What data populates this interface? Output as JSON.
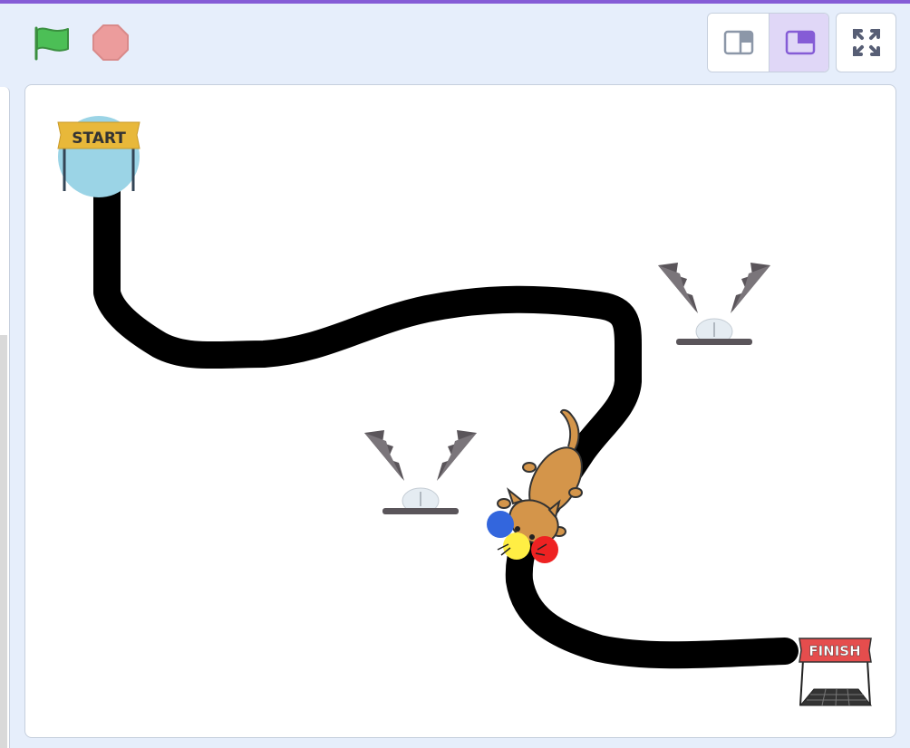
{
  "toolbar": {
    "green_flag_icon": "green-flag-icon",
    "stop_icon": "stop-sign-icon",
    "small_stage_icon": "small-stage-icon",
    "normal_stage_icon": "normal-stage-icon",
    "fullscreen_icon": "fullscreen-icon",
    "active_mode": "normal"
  },
  "stage": {
    "start_label": "START",
    "finish_label": "FINISH",
    "sprites": [
      "start-marker",
      "finish-marker",
      "trap",
      "trap",
      "cat",
      "blue-ball",
      "yellow-ball",
      "red-ball"
    ]
  },
  "colors": {
    "accent": "#855cd6",
    "flag_green": "#4cbf56",
    "stop_red": "#ec9c9c",
    "path": "#000000",
    "start_circle": "#9bd4e6",
    "start_banner": "#e8b83a",
    "finish_banner": "#e54d4d",
    "ball_blue": "#3366dd",
    "ball_yellow": "#ffee44",
    "ball_red": "#ee2222",
    "cat": "#d4954a"
  }
}
